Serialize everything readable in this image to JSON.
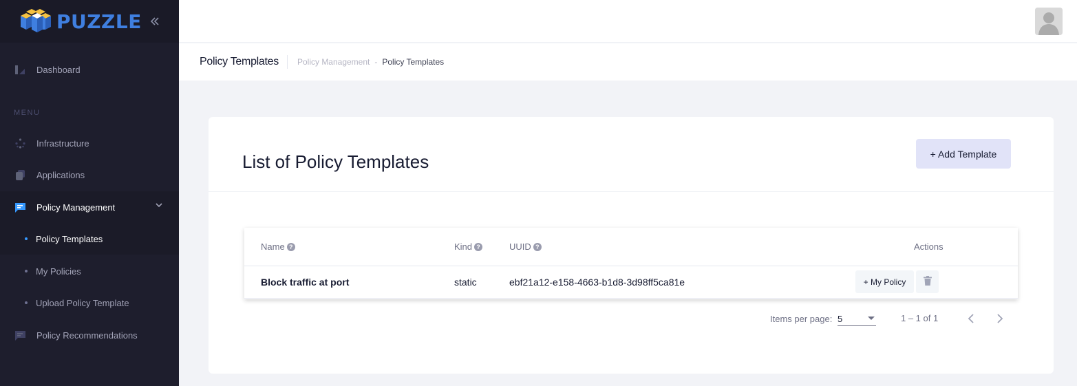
{
  "brand": {
    "name": "PUZZLE"
  },
  "sidebar": {
    "items": [
      {
        "label": "Dashboard"
      },
      {
        "label": "Infrastructure"
      },
      {
        "label": "Applications"
      },
      {
        "label": "Policy Management"
      },
      {
        "label": "Policy Recommendations"
      }
    ],
    "menu_section": "MENU",
    "policy_sub": [
      {
        "label": "Policy Templates"
      },
      {
        "label": "My Policies"
      },
      {
        "label": "Upload Policy Template"
      }
    ]
  },
  "subheader": {
    "title": "Policy Templates",
    "breadcrumb": [
      "Policy Management",
      "Policy Templates"
    ],
    "breadcrumb_sep": "-"
  },
  "card": {
    "title": "List of Policy Templates",
    "add_label": "+ Add Template"
  },
  "table": {
    "columns": [
      "Name",
      "Kind",
      "UUID",
      "Actions"
    ],
    "help_glyph": "?",
    "rows": [
      {
        "name": "Block traffic at port",
        "kind": "static",
        "uuid": "ebf21a12-e158-4663-b1d8-3d98ff5ca81e",
        "action_label": "+ My Policy"
      }
    ]
  },
  "paginator": {
    "items_per_page_label": "Items per page:",
    "items_per_page": "5",
    "range": "1 – 1 of 1"
  },
  "colors": {
    "sidebar_bg": "#1e1e2d",
    "accent": "#3699ff",
    "brand_blue": "#3f7fe0",
    "add_button_bg": "#e1e3f8"
  }
}
